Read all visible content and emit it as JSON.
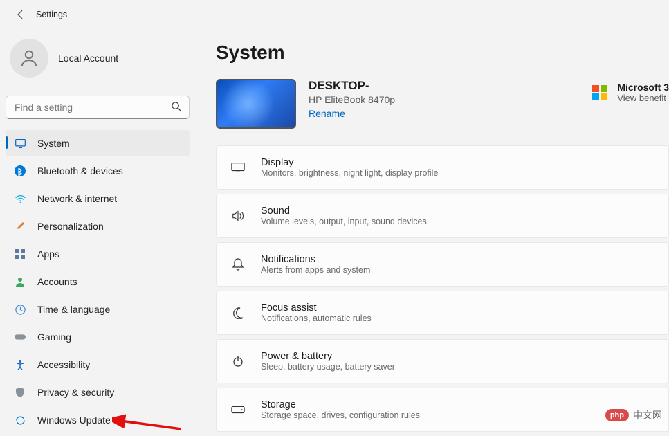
{
  "app": {
    "title": "Settings"
  },
  "account": {
    "name": "Local Account"
  },
  "search": {
    "placeholder": "Find a setting"
  },
  "sidebar": {
    "items": [
      {
        "label": "System"
      },
      {
        "label": "Bluetooth & devices"
      },
      {
        "label": "Network & internet"
      },
      {
        "label": "Personalization"
      },
      {
        "label": "Apps"
      },
      {
        "label": "Accounts"
      },
      {
        "label": "Time & language"
      },
      {
        "label": "Gaming"
      },
      {
        "label": "Accessibility"
      },
      {
        "label": "Privacy & security"
      },
      {
        "label": "Windows Update"
      }
    ]
  },
  "page": {
    "title": "System"
  },
  "device": {
    "name": "DESKTOP-",
    "model": "HP EliteBook 8470p",
    "rename": "Rename"
  },
  "microsoft": {
    "title": "Microsoft 3",
    "sub": "View benefit"
  },
  "cards": [
    {
      "title": "Display",
      "sub": "Monitors, brightness, night light, display profile"
    },
    {
      "title": "Sound",
      "sub": "Volume levels, output, input, sound devices"
    },
    {
      "title": "Notifications",
      "sub": "Alerts from apps and system"
    },
    {
      "title": "Focus assist",
      "sub": "Notifications, automatic rules"
    },
    {
      "title": "Power & battery",
      "sub": "Sleep, battery usage, battery saver"
    },
    {
      "title": "Storage",
      "sub": "Storage space, drives, configuration rules"
    }
  ],
  "watermark": {
    "badge": "php",
    "text": "中文网"
  }
}
